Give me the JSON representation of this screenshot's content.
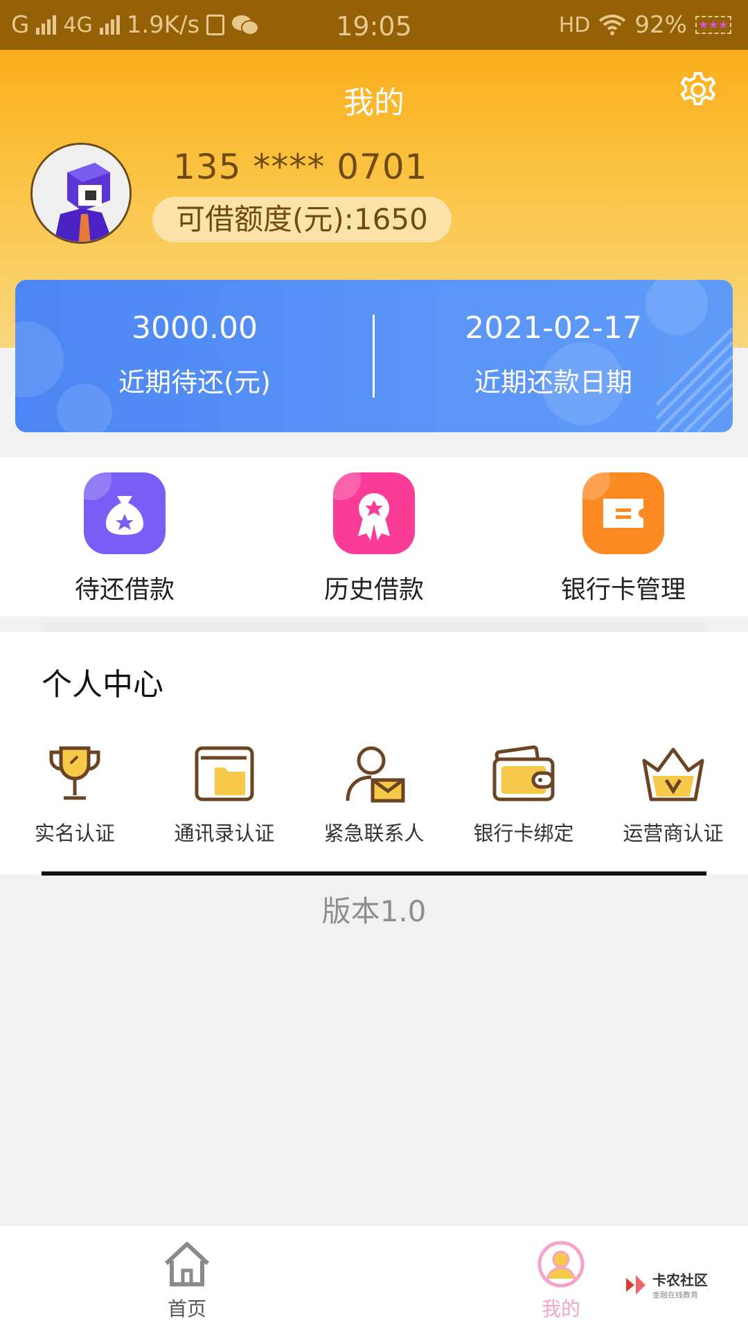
{
  "status_bar": {
    "carrier_g": "G",
    "network": "4G",
    "speed": "1.9K/s",
    "time": "19:05",
    "hd": "HD",
    "battery": "92%"
  },
  "header": {
    "title": "我的",
    "phone": "135 **** 0701",
    "quota_label": "可借额度(元):1650"
  },
  "summary_card": {
    "amount": "3000.00",
    "amount_label": "近期待还(元)",
    "date": "2021-02-17",
    "date_label": "近期还款日期"
  },
  "quick_actions": [
    {
      "label": "待还借款",
      "icon": "money-bag-icon",
      "color": "#7a5cf6"
    },
    {
      "label": "历史借款",
      "icon": "ribbon-award-icon",
      "color": "#fb3b98"
    },
    {
      "label": "银行卡管理",
      "icon": "ticket-card-icon",
      "color": "#fc8a23"
    }
  ],
  "personal_center": {
    "title": "个人中心",
    "items": [
      {
        "label": "实名认证",
        "icon": "trophy-icon"
      },
      {
        "label": "通讯录认证",
        "icon": "folder-icon"
      },
      {
        "label": "紧急联系人",
        "icon": "contact-mail-icon"
      },
      {
        "label": "银行卡绑定",
        "icon": "wallet-icon"
      },
      {
        "label": "运营商认证",
        "icon": "crown-icon"
      }
    ]
  },
  "version": "版本1.0",
  "tabbar": {
    "home": "首页",
    "mine": "我的"
  },
  "watermark": {
    "title": "卡农社区",
    "subtitle": "金融在线教育"
  },
  "colors": {
    "header_top": "#fbae1a",
    "header_bottom": "#f9d77e",
    "card_blue": "#4f8cf6",
    "active_tab": "#f7a3c9",
    "brown": "#6f4a12"
  }
}
